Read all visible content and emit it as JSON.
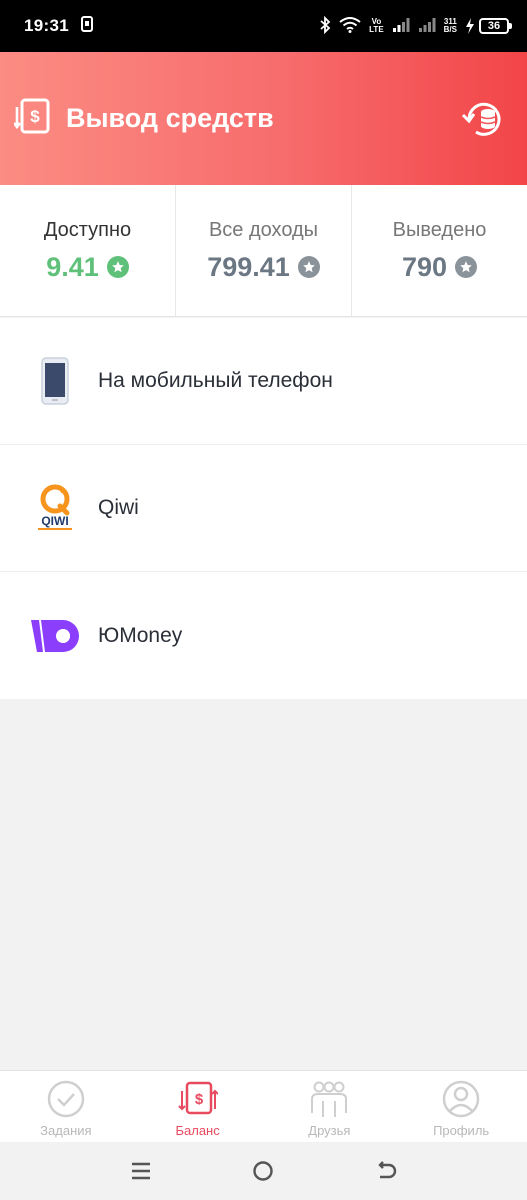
{
  "statusbar": {
    "time": "19:31",
    "network_top": "Vo",
    "network_bottom": "LTE",
    "speed_top": "311",
    "speed_bottom": "B/S",
    "battery": "36"
  },
  "header": {
    "title": "Вывод средств"
  },
  "stats": [
    {
      "label": "Доступно",
      "value": "9.41"
    },
    {
      "label": "Все доходы",
      "value": "799.41"
    },
    {
      "label": "Выведено",
      "value": "790"
    }
  ],
  "methods": [
    {
      "label": "На мобильный телефон",
      "icon": "phone-icon"
    },
    {
      "label": "Qiwi",
      "icon": "qiwi-logo",
      "logo_text": "QIWI"
    },
    {
      "label": "ЮMoney",
      "icon": "yumoney-logo"
    }
  ],
  "nav": [
    {
      "label": "Задания",
      "icon": "check-circle-icon"
    },
    {
      "label": "Баланс",
      "icon": "balance-icon"
    },
    {
      "label": "Друзья",
      "icon": "friends-icon"
    },
    {
      "label": "Профиль",
      "icon": "profile-icon"
    }
  ],
  "colors": {
    "accent": "#e84a5f",
    "header_start": "#fb8c83",
    "header_end": "#f24548",
    "available": "#5fc07a",
    "muted_value": "#6c7784",
    "yumoney": "#8b3ffd",
    "qiwi": "#f7941d"
  }
}
